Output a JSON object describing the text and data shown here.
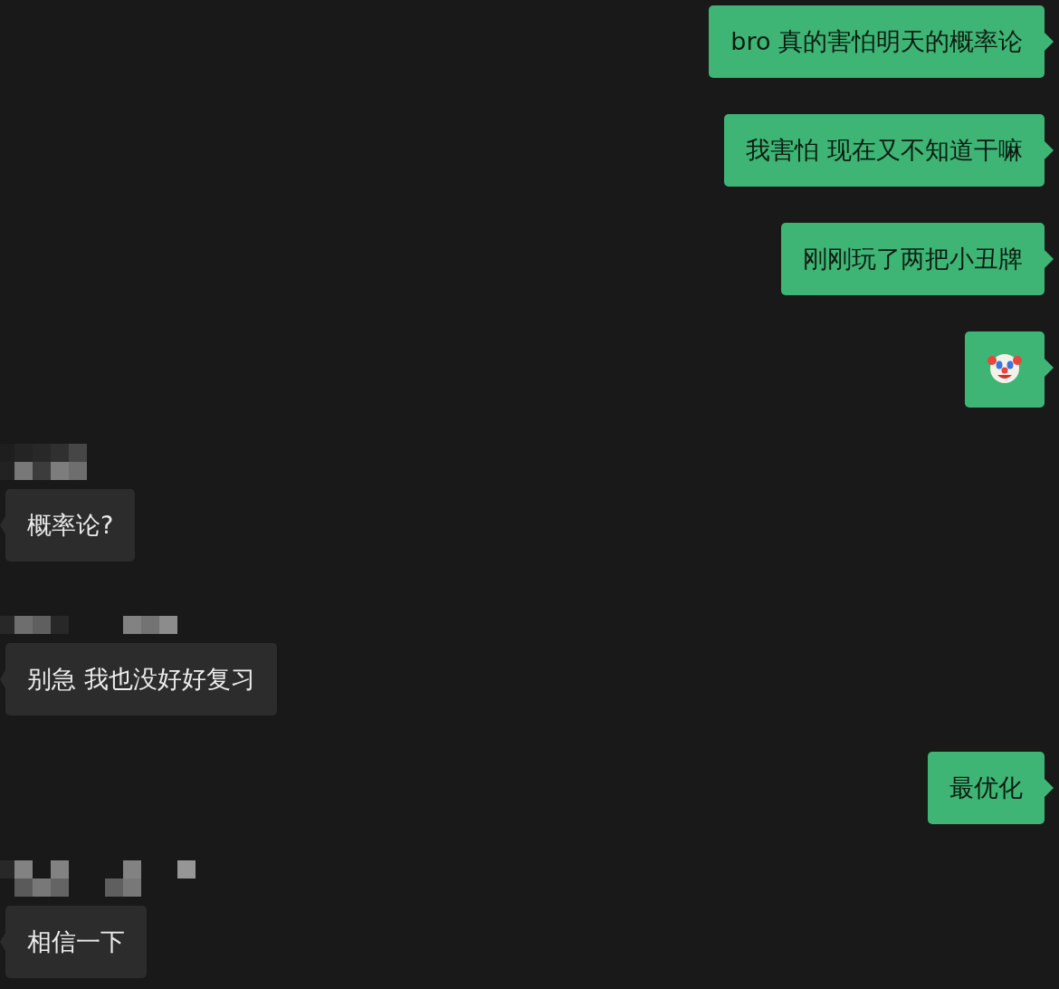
{
  "messages": [
    {
      "kind": "outgoing",
      "text": "bro 真的害怕明天的概率论"
    },
    {
      "kind": "outgoing",
      "text": "我害怕 现在又不知道干嘛"
    },
    {
      "kind": "outgoing",
      "text": "刚刚玩了两把小丑牌"
    },
    {
      "kind": "outgoing-emoji"
    },
    {
      "kind": "redacted-name"
    },
    {
      "kind": "incoming",
      "text": "概率论?"
    },
    {
      "kind": "redacted-name"
    },
    {
      "kind": "incoming",
      "text": "别急 我也没好好复习"
    },
    {
      "kind": "outgoing",
      "text": "最优化"
    },
    {
      "kind": "redacted-name"
    },
    {
      "kind": "incoming",
      "text": "相信一下"
    }
  ]
}
